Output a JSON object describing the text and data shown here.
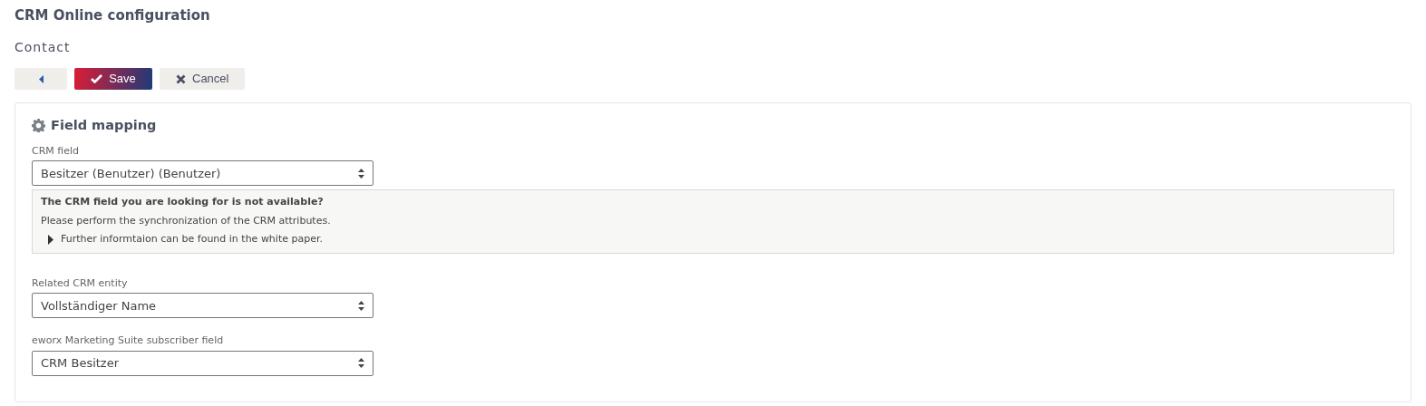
{
  "title": "CRM Online configuration",
  "subtitle": "Contact",
  "buttons": [
    {
      "kind": "back"
    },
    {
      "kind": "save",
      "label": "Save"
    },
    {
      "kind": "cancel",
      "label": "Cancel"
    }
  ],
  "section": {
    "title": "Field mapping",
    "fields": [
      {
        "label": "CRM field",
        "value": "Besitzer (Benutzer) (Benutzer)",
        "info": {
          "title": "The CRM field you are looking for is not available?",
          "text": "Please perform the synchronization of the CRM attributes.",
          "link": "Further informtaion can be found in the white paper."
        }
      },
      {
        "label": "Related CRM entity",
        "value": "Vollständiger Name"
      },
      {
        "label": "eworx Marketing Suite subscriber field",
        "value": "CRM Besitzer"
      }
    ]
  }
}
